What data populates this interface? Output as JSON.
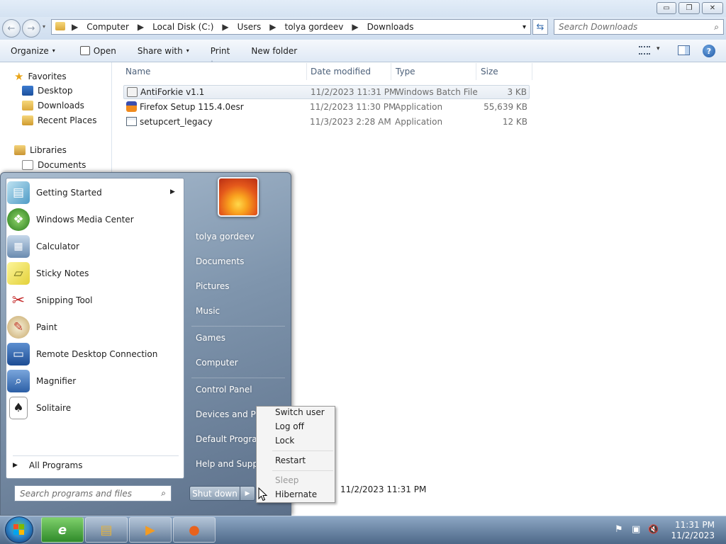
{
  "window": {
    "minimize_glyph": "▭",
    "maximize_glyph": "❐",
    "close_glyph": "✕"
  },
  "address_bar": {
    "back_glyph": "←",
    "forward_glyph": "→",
    "breadcrumb": [
      "Computer",
      "Local Disk (C:)",
      "Users",
      "tolya gordeev",
      "Downloads"
    ],
    "dropdown_glyph": "▾",
    "refresh_glyph": "⇆"
  },
  "search": {
    "placeholder": "Search Downloads"
  },
  "toolbar": {
    "organize": "Organize",
    "open": "Open",
    "share_with": "Share with",
    "print": "Print",
    "new_folder": "New folder",
    "dropdown_glyph": "▾",
    "help_glyph": "?"
  },
  "nav_pane": {
    "favorites": "Favorites",
    "desktop": "Desktop",
    "downloads": "Downloads",
    "recent_places": "Recent Places",
    "libraries": "Libraries",
    "documents": "Documents"
  },
  "file_list": {
    "columns": {
      "name": "Name",
      "date_modified": "Date modified",
      "type": "Type",
      "size": "Size"
    },
    "rows": [
      {
        "name": "AntiForkie v1.1",
        "date": "11/2/2023 11:31 PM",
        "type": "Windows Batch File",
        "size": "3 KB",
        "selected": true
      },
      {
        "name": "Firefox Setup 115.4.0esr",
        "date": "11/2/2023 11:30 PM",
        "type": "Application",
        "size": "55,639 KB",
        "selected": false
      },
      {
        "name": "setupcert_legacy",
        "date": "11/3/2023 2:28 AM",
        "type": "Application",
        "size": "12 KB",
        "selected": false
      }
    ]
  },
  "details_pane": {
    "date_value": "11/2/2023 11:31 PM"
  },
  "start_menu": {
    "programs": [
      {
        "label": "Getting Started",
        "icon": "getting-started-icon"
      },
      {
        "label": "Windows Media Center",
        "icon": "media-center-icon"
      },
      {
        "label": "Calculator",
        "icon": "calculator-icon"
      },
      {
        "label": "Sticky Notes",
        "icon": "sticky-notes-icon"
      },
      {
        "label": "Snipping Tool",
        "icon": "snipping-tool-icon"
      },
      {
        "label": "Paint",
        "icon": "paint-icon"
      },
      {
        "label": "Remote Desktop Connection",
        "icon": "remote-desktop-icon"
      },
      {
        "label": "Magnifier",
        "icon": "magnifier-icon"
      },
      {
        "label": "Solitaire",
        "icon": "solitaire-icon"
      }
    ],
    "submenu_glyph": "▶",
    "all_programs": "All Programs",
    "search_placeholder": "Search programs and files",
    "right_links": {
      "user": "tolya gordeev",
      "documents": "Documents",
      "pictures": "Pictures",
      "music": "Music",
      "games": "Games",
      "computer": "Computer",
      "control_panel": "Control Panel",
      "devices_and_printers": "Devices and Printers",
      "default_programs": "Default Programs",
      "help_and_support": "Help and Support"
    },
    "shutdown": "Shut down",
    "shutdown_arrow_glyph": "▶"
  },
  "shutdown_submenu": {
    "switch_user": "Switch user",
    "log_off": "Log off",
    "lock": "Lock",
    "restart": "Restart",
    "sleep": "Sleep",
    "hibernate": "Hibernate"
  },
  "taskbar": {
    "pinned": [
      {
        "icon": "internet-explorer-icon",
        "glyph": "e"
      },
      {
        "icon": "windows-explorer-icon",
        "glyph": "▤"
      },
      {
        "icon": "media-player-icon",
        "glyph": "▶"
      },
      {
        "icon": "firefox-icon",
        "glyph": "●"
      }
    ],
    "tray_flag_glyph": "⚑",
    "tray_network_glyph": "▣",
    "tray_volume_glyph": "🔇",
    "clock_time": "11:31 PM",
    "clock_date": "11/2/2023"
  },
  "colors": {
    "accent": "#3a6fb0",
    "taskbar": "#4d6888",
    "startmenu_right": "#7f95ad"
  }
}
